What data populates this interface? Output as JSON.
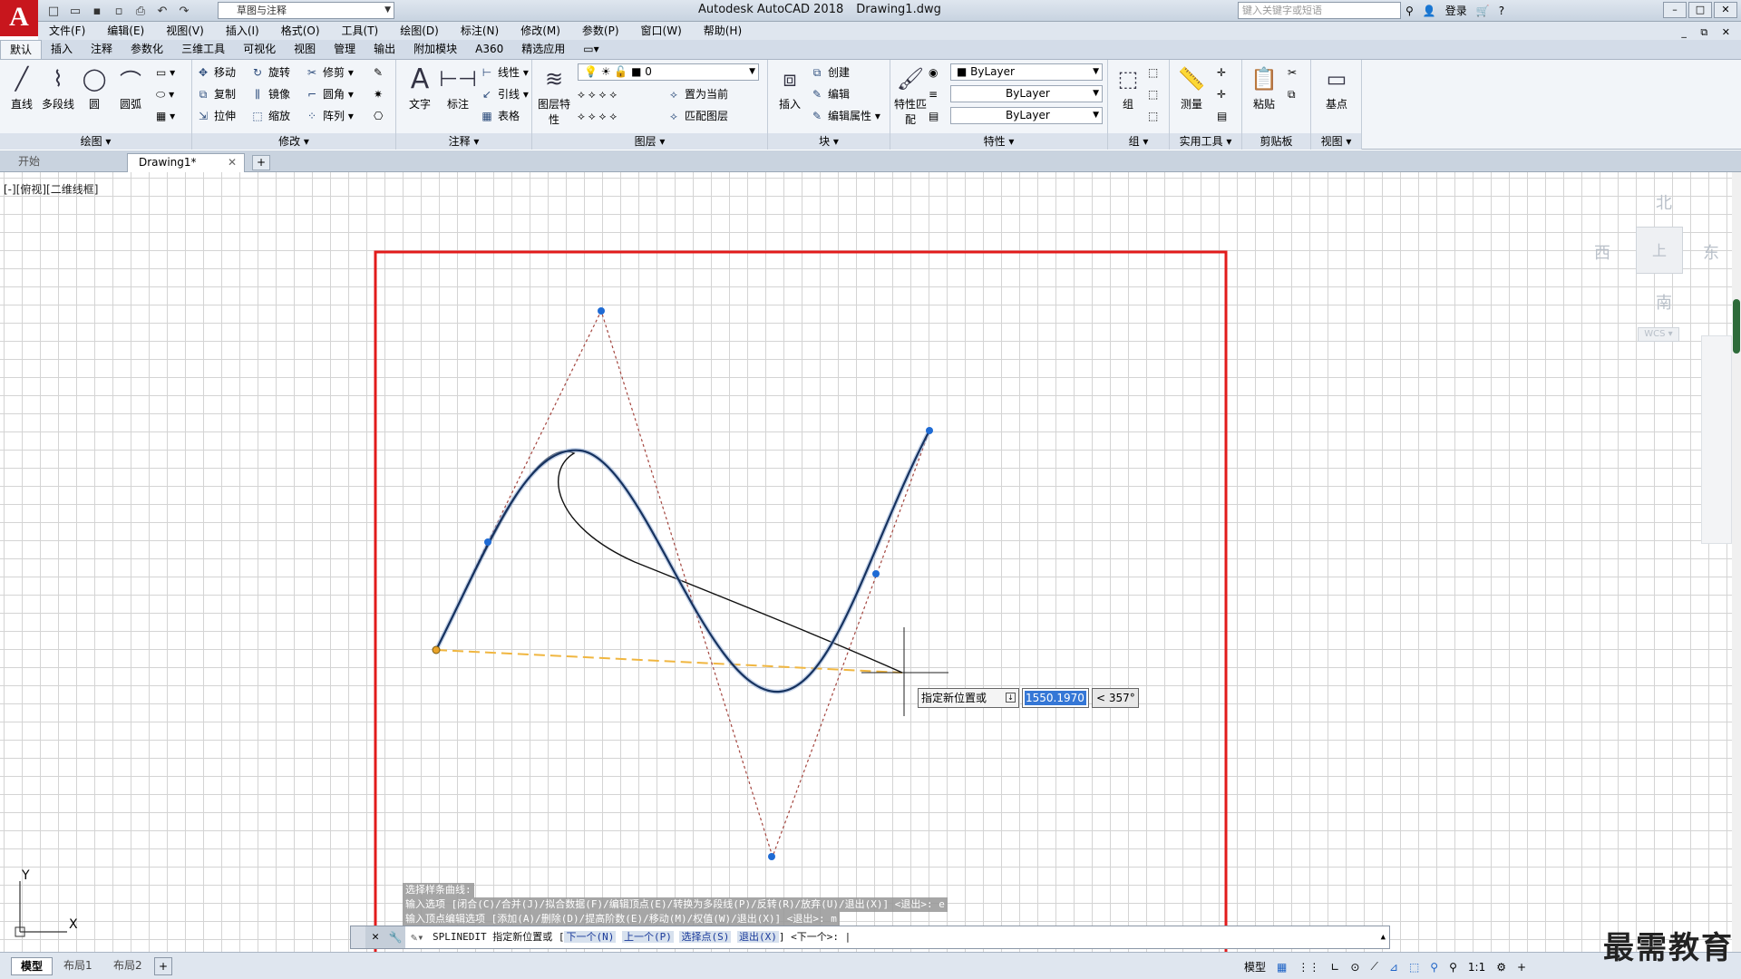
{
  "titlebar": {
    "app_logo": "A",
    "workspace": "草图与注释",
    "app_name": "Autodesk AutoCAD 2018",
    "file_name": "Drawing1.dwg",
    "search_placeholder": "键入关键字或短语",
    "signin": "登录",
    "help": "?"
  },
  "menu": [
    "文件(F)",
    "编辑(E)",
    "视图(V)",
    "插入(I)",
    "格式(O)",
    "工具(T)",
    "绘图(D)",
    "标注(N)",
    "修改(M)",
    "参数(P)",
    "窗口(W)",
    "帮助(H)"
  ],
  "ribbon_tabs": [
    "默认",
    "插入",
    "注释",
    "参数化",
    "三维工具",
    "可视化",
    "视图",
    "管理",
    "输出",
    "附加模块",
    "A360",
    "精选应用"
  ],
  "ribbon": {
    "draw": {
      "title": "绘图",
      "line": "直线",
      "polyline": "多段线",
      "circle": "圆",
      "arc": "圆弧"
    },
    "modify": {
      "title": "修改",
      "move": "移动",
      "rotate": "旋转",
      "trim": "修剪",
      "copy": "复制",
      "mirror": "镜像",
      "fillet": "圆角",
      "stretch": "拉伸",
      "scale": "缩放",
      "array": "阵列"
    },
    "annotation": {
      "title": "注释",
      "text": "文字",
      "dimension": "标注",
      "linear": "线性",
      "leader": "引线",
      "table": "表格"
    },
    "layers": {
      "title": "图层",
      "layer_props": "图层特性",
      "current_layer": "0",
      "set_current": "置为当前",
      "match_layer": "匹配图层"
    },
    "block": {
      "title": "块",
      "insert": "插入",
      "create": "创建",
      "edit": "编辑",
      "edit_attr": "编辑属性"
    },
    "properties": {
      "title": "特性",
      "match": "特性匹配",
      "color": "ByLayer",
      "linetype": "ByLayer",
      "lineweight": "ByLayer"
    },
    "groups": {
      "title": "组",
      "group": "组"
    },
    "utilities": {
      "title": "实用工具",
      "measure": "测量"
    },
    "clipboard": {
      "title": "剪贴板",
      "paste": "粘贴"
    },
    "view": {
      "title": "视图",
      "base": "基点"
    }
  },
  "doc_tabs": {
    "start": "开始",
    "active": "Drawing1*"
  },
  "viewport_label": "[-][俯视][二维线框]",
  "viewcube": {
    "north": "北",
    "south": "南",
    "east": "东",
    "west": "西",
    "top": "上",
    "wcs": "WCS"
  },
  "ucs": {
    "x": "X",
    "y": "Y"
  },
  "tooltip": {
    "label": "指定新位置或",
    "value": "1550.1970",
    "angle": "< 357°"
  },
  "command_history": [
    "选择样条曲线:",
    "输入选项 [闭合(C)/合并(J)/拟合数据(F)/编辑顶点(E)/转换为多段线(P)/反转(R)/放弃(U)/退出(X)] <退出>: e",
    "输入顶点编辑选项 [添加(A)/删除(D)/提高阶数(E)/移动(M)/权值(W)/退出(X)] <退出>: m"
  ],
  "command_line": {
    "prefix": "SPLINEDIT 指定新位置或 [",
    "opt_next": "下一个(N)",
    "opt_prev": "上一个(P)",
    "opt_select": "选择点(S)",
    "opt_exit": "退出(X)",
    "suffix": "] <下一个>: |"
  },
  "layout_tabs": [
    "模型",
    "布局1",
    "布局2"
  ],
  "status": {
    "model": "模型",
    "scale": "1:1"
  },
  "watermark": "最需教育",
  "colors": {
    "accent": "#c8161d",
    "highlight_frame": "#e21b1b",
    "spline": "#16325f",
    "control_dash": "#a4463f",
    "rubber_band": "#f0b640",
    "grip": "#1f6bd4"
  }
}
